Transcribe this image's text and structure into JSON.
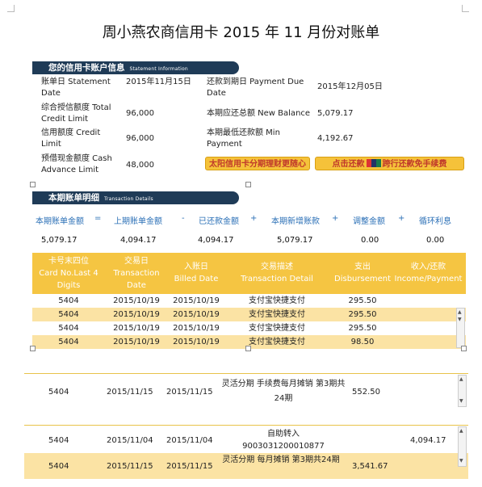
{
  "title": "周小燕农商信用卡 2015 年 11 月份对账单",
  "account": {
    "header": "您的信用卡账户信息",
    "header_en": "Statement Information",
    "statement_date_label": "账单日 Statement Date",
    "statement_date": "2015年11月15日",
    "payment_due_label": "还款到期日 Payment Due Date",
    "payment_due": "2015年12月05日",
    "credit_limit_label": "综合授信额度 Total Credit Limit",
    "credit_limit": "96,000",
    "new_balance_label": "本期应还总额 New Balance",
    "new_balance": "5,079.17",
    "credit_label": "信用额度 Credit Limit",
    "credit": "96,000",
    "min_label": "本期最低还款额 Min Payment",
    "min": "4,192.67",
    "cash_label": "预借现金额度 Cash Advance Limit",
    "cash": "48,000",
    "btn1": "太阳信用卡分期理财更随心",
    "btn2a": "点击还款",
    "btn2_icon": "银联支付",
    "btn2b": "跨行还款免手续费"
  },
  "details": {
    "header": "本期账单明细",
    "header_en": "Transaction Details",
    "summary_labels": [
      "本期账单金额",
      "=",
      "上期账单金额",
      "-",
      "已还款金额",
      "+",
      "本期新增账款",
      "+",
      "调整金额",
      "+",
      "循环利息"
    ],
    "summary_values": [
      "5,079.17",
      "4,094.17",
      "4,094.17",
      "5,079.17",
      "0.00",
      "0.00"
    ],
    "columns": [
      {
        "zh": "卡号末四位",
        "en": "Card No.Last 4 Digits"
      },
      {
        "zh": "交易日",
        "en": "Transaction Date"
      },
      {
        "zh": "入账日",
        "en": "Billed Date"
      },
      {
        "zh": "交易描述",
        "en": "Transaction Detail"
      },
      {
        "zh": "支出",
        "en": "Disbursement"
      },
      {
        "zh": "收入/还款",
        "en": "Income/Payment"
      }
    ],
    "rows": [
      [
        "5404",
        "2015/10/19",
        "2015/10/19",
        "支付宝快捷支付",
        "295.50",
        ""
      ],
      [
        "5404",
        "2015/10/19",
        "2015/10/19",
        "支付宝快捷支付",
        "295.50",
        ""
      ],
      [
        "5404",
        "2015/10/19",
        "2015/10/19",
        "支付宝快捷支付",
        "295.50",
        ""
      ],
      [
        "5404",
        "2015/10/19",
        "2015/10/19",
        "支付宝快捷支付",
        "98.50",
        ""
      ]
    ],
    "lower_rows": [
      [
        "5404",
        "2015/11/15",
        "2015/11/15",
        "灵活分期 手续费每月摊销 第3期共24期",
        "552.50",
        ""
      ],
      [
        "5404",
        "2015/11/04",
        "2015/11/04",
        "自助转入 9003031200010877",
        "",
        "4,094.17"
      ],
      [
        "5404",
        "2015/11/15",
        "2015/11/15",
        "灵活分期 每月摊销 第3期共24期",
        "3,541.67",
        ""
      ]
    ]
  },
  "colors": {
    "navy": "#1f3b57",
    "gold": "#f5c542",
    "stripe": "#fbe3a4",
    "blue": "#2a6fb6",
    "red": "#c0392b"
  }
}
